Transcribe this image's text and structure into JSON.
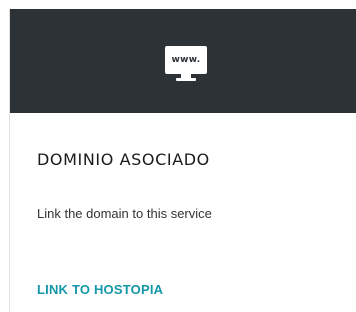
{
  "card": {
    "icon_text": "www.",
    "icon_name": "monitor-www-icon",
    "title": "DOMINIO ASOCIADO",
    "description": "Link the domain to this service",
    "link_label": "LINK TO HOSTOPIA"
  },
  "colors": {
    "header_bg": "#2d3237",
    "link": "#1497a8",
    "title": "#1a1a1a",
    "text": "#333333"
  }
}
